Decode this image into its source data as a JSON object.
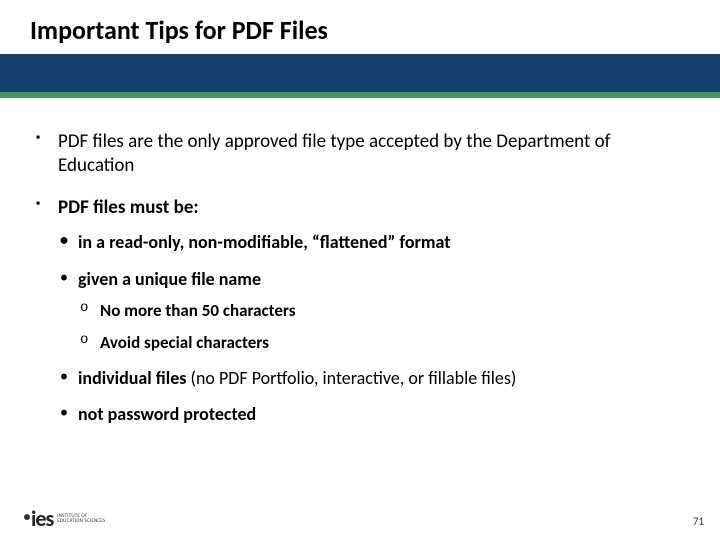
{
  "title": "Important Tips for PDF Files",
  "bullets": {
    "b1": "PDF files are the only approved file type accepted by the Department of Education",
    "b2": "PDF files must be:",
    "b2_1": "in a read-only, non-modifiable, “flattened” format",
    "b2_2": "given a unique file name",
    "b2_2_1": "No more than 50 characters",
    "b2_2_2": "Avoid special characters",
    "b2_3_lead": "individual files",
    "b2_3_rest": " (no PDF Portfolio, interactive, or fillable files)",
    "b2_4": "not password protected"
  },
  "footer": {
    "page": "71",
    "logo_brand": "ies",
    "logo_line1": "Institute of",
    "logo_line2": "Education Sciences"
  }
}
